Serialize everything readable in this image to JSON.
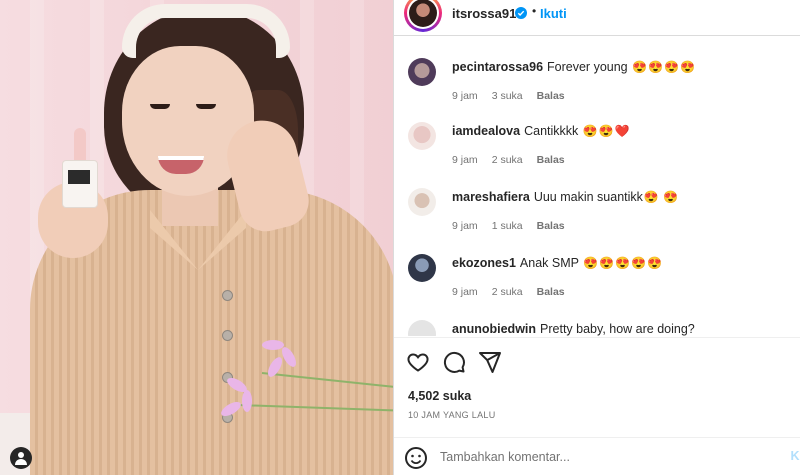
{
  "header": {
    "username": "itsrossa910",
    "dot": "•",
    "follow_label": "Ikuti"
  },
  "comments": [
    {
      "user": "pecintarossa96",
      "text": "Forever young",
      "emojis": [
        "😍",
        "😍",
        "😍",
        "😍"
      ],
      "time": "9 jam",
      "likes": "3 suka",
      "reply": "Balas"
    },
    {
      "user": "iamdealova",
      "text": "Cantikkkk",
      "emojis": [
        "😍",
        "😍",
        "❤️"
      ],
      "time": "9 jam",
      "likes": "2 suka",
      "reply": "Balas"
    },
    {
      "user": "mareshafiera",
      "text": "Uuu makin suantikk",
      "emojis": [
        "😍",
        "😍"
      ],
      "time": "9 jam",
      "likes": "1 suka",
      "reply": "Balas"
    },
    {
      "user": "ekozones1",
      "text": "Anak SMP",
      "emojis": [
        "😍",
        "😍",
        "😍",
        "😍",
        "😍"
      ],
      "time": "9 jam",
      "likes": "2 suka",
      "reply": "Balas"
    },
    {
      "user": "anunobiedwin",
      "text": "Pretty baby, how are doing?",
      "emojis": [],
      "time": "",
      "likes": "",
      "reply": ""
    }
  ],
  "post": {
    "likes": "4,502 suka",
    "time": "10 JAM YANG LALU"
  },
  "add_comment": {
    "placeholder": "Tambahkan komentar...",
    "post_label": "Ki"
  },
  "icons": {
    "like": "heart-icon",
    "comment": "comment-icon",
    "share": "share-icon",
    "emoji": "smile-icon",
    "tagged": "user-icon",
    "verified": "verified-badge-icon"
  },
  "colors": {
    "accent": "#0095f6",
    "text": "#262626",
    "muted": "#737373",
    "post_disabled": "#b2dffc",
    "emoji_heart": "#e0245e"
  }
}
